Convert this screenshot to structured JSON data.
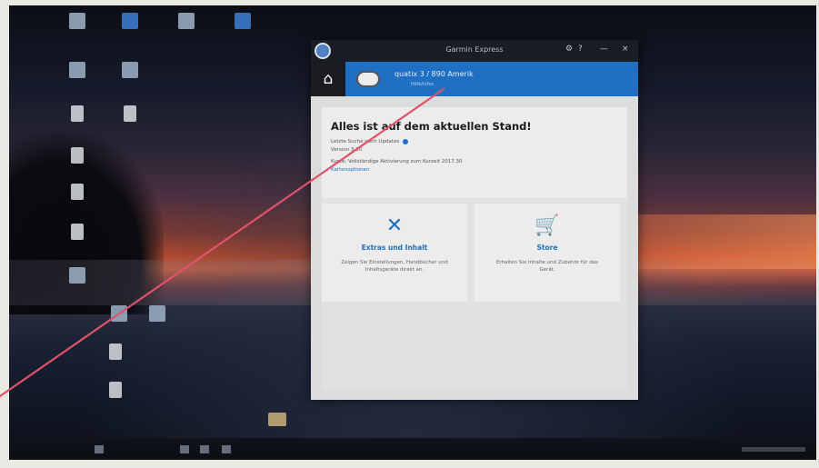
{
  "desktop": {
    "icons": [
      {
        "caption": "",
        "kind": "normal"
      },
      {
        "caption": "",
        "kind": "blue"
      },
      {
        "caption": "",
        "kind": "normal"
      },
      {
        "caption": "",
        "kind": "blue"
      },
      {
        "caption": "",
        "kind": "normal"
      },
      {
        "caption": "",
        "kind": "normal"
      },
      {
        "caption": "",
        "kind": "doc"
      },
      {
        "caption": "",
        "kind": "doc"
      },
      {
        "caption": "",
        "kind": "doc"
      },
      {
        "caption": "",
        "kind": "doc"
      },
      {
        "caption": "",
        "kind": "doc"
      },
      {
        "caption": "",
        "kind": "normal"
      },
      {
        "caption": "",
        "kind": "normal"
      },
      {
        "caption": "",
        "kind": "normal"
      },
      {
        "caption": "",
        "kind": "doc"
      },
      {
        "caption": "",
        "kind": "doc"
      },
      {
        "caption": "",
        "kind": "folder"
      }
    ]
  },
  "window": {
    "title": "Garmin Express",
    "controls": {
      "settings": "⚙",
      "help": "?",
      "minimize": "—",
      "close": "×"
    }
  },
  "navbar": {
    "home_icon": "⌂",
    "device_name": "quatix 3 / 890 Amerik",
    "device_sub": "Hilfe/Infos"
  },
  "status": {
    "title": "Alles ist auf dem aktuellen Stand!",
    "last_check": "Letzte Suche nach Updates",
    "line2": "Version 3.20",
    "line3": "Kurze: Vollständige Aktivierung zum Kurzeit 2017.30",
    "link": "Kartenoptionen"
  },
  "tiles": [
    {
      "icon": "✕",
      "title": "Extras und Inhalt",
      "desc": "Zeigen Sie Einstellungen, Handbücher und Inhaltsgeräte direkt an."
    },
    {
      "icon": "🛒",
      "title": "Store",
      "desc": "Erhalten Sie Inhalte und Zubehör für das Gerät."
    }
  ],
  "colors": {
    "accent": "#1f6fc2",
    "titlebar": "#1b1d24",
    "pen": "#e0526a"
  }
}
